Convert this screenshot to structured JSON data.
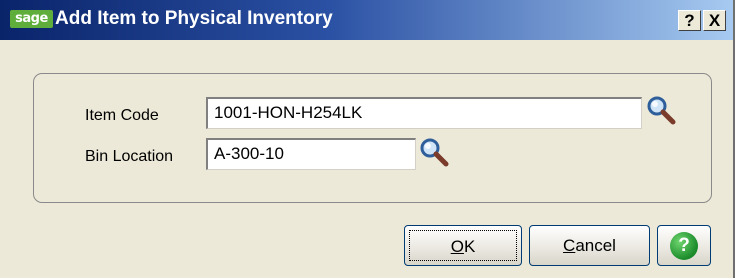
{
  "window": {
    "title": "Add Item to Physical Inventory",
    "logo_text": "sage",
    "help_label": "?",
    "close_label": "X"
  },
  "form": {
    "item_code_label": "Item Code",
    "item_code_value": "1001-HON-H254LK",
    "bin_location_label": "Bin Location",
    "bin_location_value": "A-300-10"
  },
  "buttons": {
    "ok_first": "O",
    "ok_rest": "K",
    "cancel_first": "C",
    "cancel_rest": "ancel",
    "help_symbol": "?"
  },
  "colors": {
    "titlebar_start": "#0a246a",
    "titlebar_end": "#a6caf0",
    "dialog_bg": "#ece9d8",
    "help_green": "#1a8a2a"
  }
}
